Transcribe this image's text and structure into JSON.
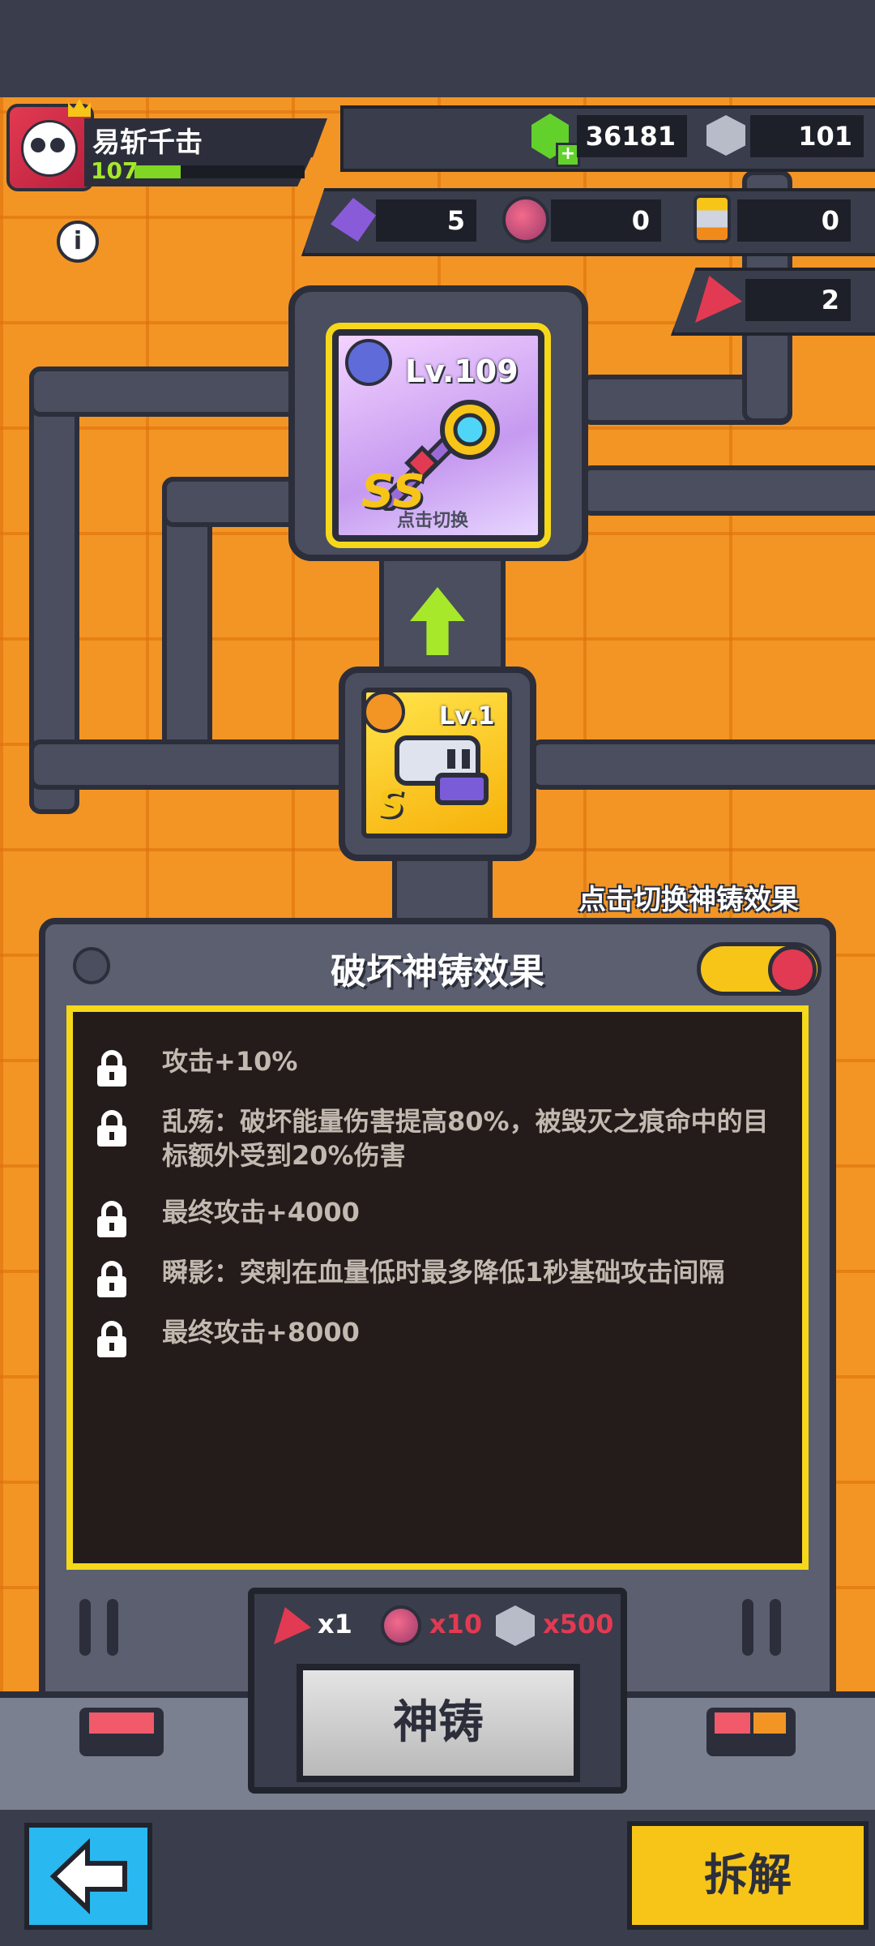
{
  "player": {
    "name": "易斩千击",
    "level": "107",
    "xp_fraction": 0.27
  },
  "resources": {
    "gems": "36181",
    "cubes": "101",
    "crystals": "5",
    "orbs": "0",
    "capsules": "0",
    "tokens": "2"
  },
  "target_item": {
    "level": "Lv.109",
    "grade": "SS",
    "caption": "点击切换"
  },
  "material_item": {
    "level": "Lv.1",
    "grade": "S"
  },
  "hint_text": "点击切换神铸效果",
  "panel": {
    "title": "破坏神铸效果",
    "effects": [
      {
        "text": "攻击+10%"
      },
      {
        "text": "乱殇：破坏能量伤害提高80%，被毁灭之痕命中的目标额外受到20%伤害"
      },
      {
        "text": "最终攻击+4000"
      },
      {
        "text": "瞬影：突刺在血量低时最多降低1秒基础攻击间隔"
      },
      {
        "text": "最终攻击+8000"
      }
    ]
  },
  "cost": {
    "token": "x1",
    "orb": "x10",
    "cube": "x500"
  },
  "buttons": {
    "forge": "神铸",
    "dismantle": "拆解"
  },
  "colors": {
    "accent_yellow": "#f6d81a",
    "background_orange": "#f39524",
    "panel_gray": "#5b5f70",
    "cost_red": "#e23a52"
  },
  "icons": [
    "gem-icon",
    "cube-icon",
    "crystal-icon",
    "orb-icon",
    "capsule-icon",
    "token-icon",
    "lock-icon",
    "info-icon",
    "arrow-up-icon",
    "back-arrow-icon"
  ]
}
